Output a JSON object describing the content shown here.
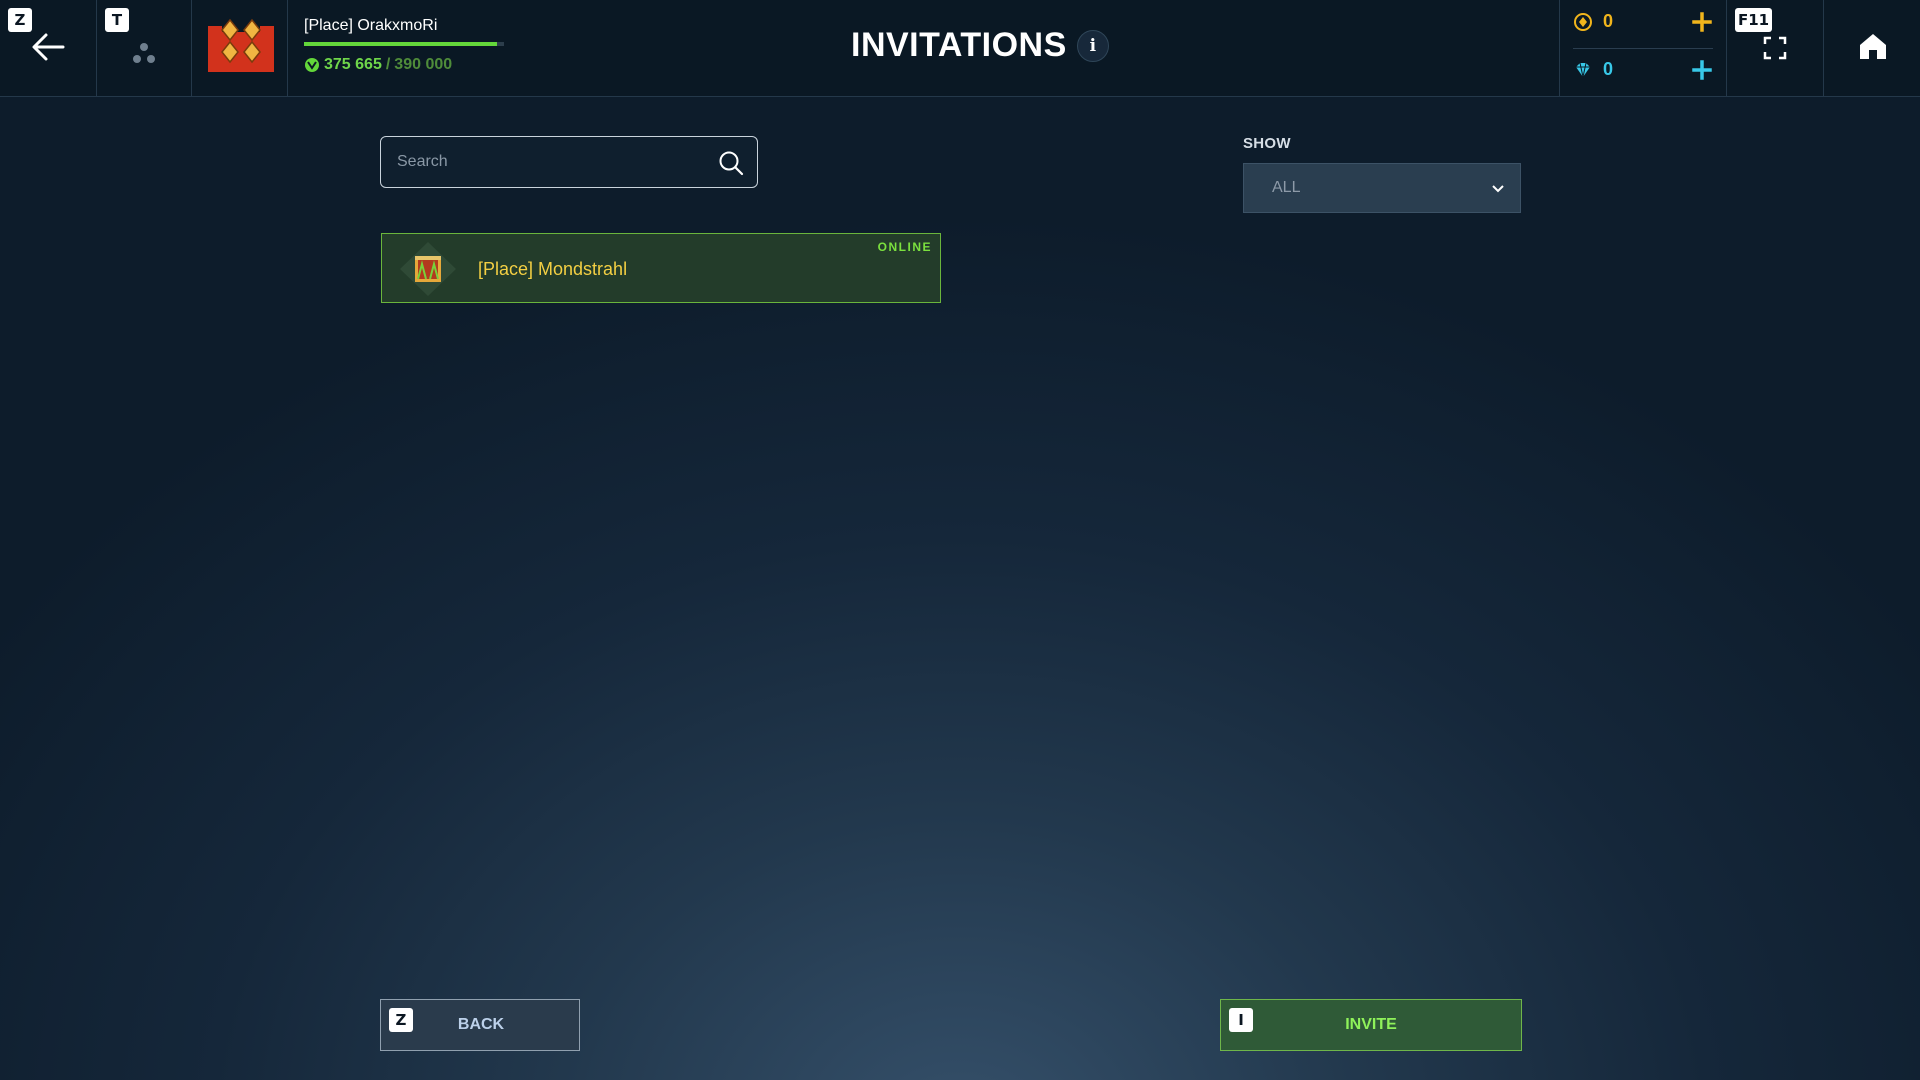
{
  "header": {
    "back_hotkey": "Z",
    "team_hotkey": "T",
    "fullscreen_hotkey": "F11",
    "title": "INVITATIONS",
    "info_symbol": "i"
  },
  "player": {
    "name": "[Place] OrakxmoRi",
    "xp_current": "375 665",
    "xp_separator": "/",
    "xp_max": "390 000",
    "xp_progress_fraction": 0.9632
  },
  "currency": {
    "gold_value": "0",
    "gems_value": "0",
    "gold_color": "#f1b51c",
    "gems_color": "#38c8e8"
  },
  "search": {
    "placeholder": "Search",
    "value": ""
  },
  "filter": {
    "label": "SHOW",
    "selected": "ALL"
  },
  "friends": [
    {
      "name": "[Place] Mondstrahl",
      "status": "ONLINE"
    }
  ],
  "footer": {
    "back_hotkey": "Z",
    "back_label": "BACK",
    "invite_hotkey": "I",
    "invite_label": "INVITE"
  },
  "icons": {
    "back": "arrow-left-icon",
    "team": "team-icon",
    "emblem": "clan-emblem-icon",
    "xp": "xp-icon",
    "info": "info-icon",
    "gold": "gold-coin-icon",
    "gems": "gem-icon",
    "add": "plus-icon",
    "fullscreen": "fullscreen-icon",
    "home": "home-icon",
    "search": "search-icon",
    "dropdown": "chevron-down-icon"
  }
}
